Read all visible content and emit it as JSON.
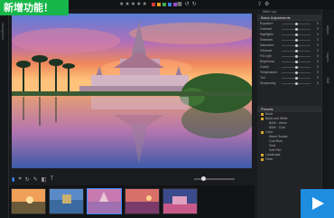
{
  "badge": {
    "text": "新增功能！"
  },
  "leftstrip": {
    "label": "Navigation"
  },
  "toolbar": {
    "stars": "★★★★★"
  },
  "colors": {
    "badge": "#17b64a",
    "accent": "#3a8cff",
    "play": "#1e8de0",
    "flags": [
      "#d63a3a",
      "#e0a020",
      "#3fae4a",
      "#3a7fe0",
      "#9a4fd0"
    ]
  },
  "panel": {
    "top_label": "Main Lyr",
    "basic_adjustments": {
      "title": "Basic Adjustments",
      "rows": [
        {
          "label": "Exposure",
          "value": "0"
        },
        {
          "label": "Contrast",
          "value": "0"
        },
        {
          "label": "Highlights",
          "value": "0"
        },
        {
          "label": "Shadows",
          "value": "0"
        },
        {
          "label": "Saturation",
          "value": "0"
        },
        {
          "label": "Vibrance",
          "value": "0"
        },
        {
          "label": "Fill Light",
          "value": "0"
        },
        {
          "label": "Brightness",
          "value": "0"
        },
        {
          "label": "Clarity",
          "value": "0"
        },
        {
          "label": "Temperature",
          "value": "0"
        },
        {
          "label": "Tint",
          "value": "0"
        },
        {
          "label": "Sharpening",
          "value": "0"
        }
      ]
    },
    "presets": {
      "title": "Presets",
      "items": [
        {
          "label": "Basic",
          "type": "folder"
        },
        {
          "label": "Black and White",
          "type": "folder"
        },
        {
          "label": "B&W - Warm",
          "type": "sub"
        },
        {
          "label": "B&W - Cold",
          "type": "sub"
        },
        {
          "label": "Color",
          "type": "folder"
        },
        {
          "label": "Warm Sunset",
          "type": "sub"
        },
        {
          "label": "Cool Blue",
          "type": "sub"
        },
        {
          "label": "Vivid",
          "type": "sub"
        },
        {
          "label": "Soft Film",
          "type": "sub"
        },
        {
          "label": "Landscape",
          "type": "folder"
        },
        {
          "label": "Other",
          "type": "folder"
        }
      ]
    },
    "right_tabs": [
      "Adjust",
      "Layers",
      "Edit"
    ]
  }
}
